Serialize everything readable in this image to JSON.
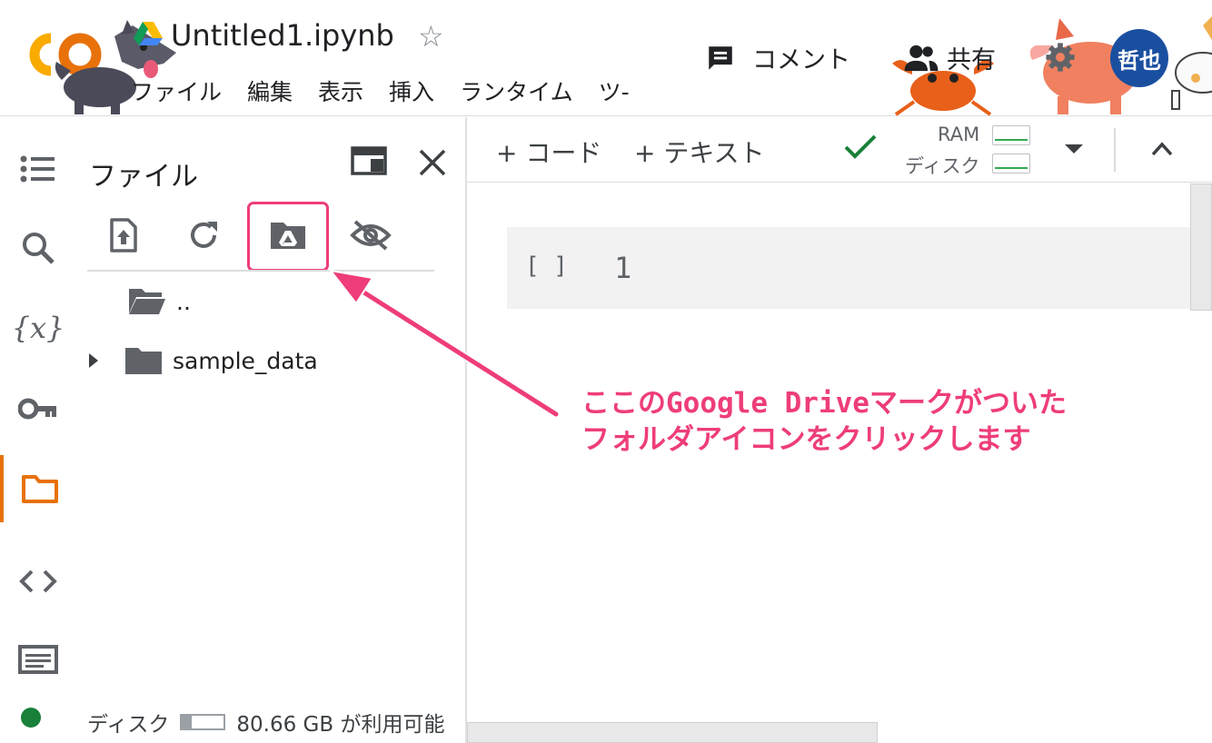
{
  "header": {
    "doc_title": "Untitled1.ipynb",
    "menu": [
      "ファイル",
      "編集",
      "表示",
      "挿入",
      "ランタイム",
      "ツ-"
    ],
    "comment_label": "コメント",
    "share_label": "共有",
    "avatar_text": "哲也"
  },
  "rail": {
    "items": [
      "toc-icon",
      "search-icon",
      "variables-icon",
      "key-icon",
      "folder-icon",
      "code-icon",
      "terminal-icon"
    ],
    "active": "folder-icon",
    "status_color": "#188038"
  },
  "files": {
    "title": "ファイル",
    "toolbar": [
      "upload-file-icon",
      "refresh-icon",
      "mount-drive-icon",
      "hide-icon"
    ],
    "tree": [
      {
        "name": "..",
        "type": "folder-open"
      },
      {
        "name": "sample_data",
        "type": "folder"
      }
    ],
    "disk_label": "ディスク",
    "disk_free": "80.66 GB が利用可能"
  },
  "notebook": {
    "add_code": "+ コード",
    "add_text": "+ テキスト",
    "ram_label": "RAM",
    "disk_label": "ディスク",
    "cell": {
      "brackets": "[ ]",
      "line_number": "1"
    }
  },
  "annotation": {
    "line1": "ここのGoogle Driveマークがついた",
    "line2": "フォルダアイコンをクリックします",
    "color": "#ee3d7a"
  },
  "colors": {
    "accent": "#e8710a",
    "highlight": "#ee3d7a",
    "check": "#188038",
    "avatar_bg": "#1a4fa0"
  }
}
